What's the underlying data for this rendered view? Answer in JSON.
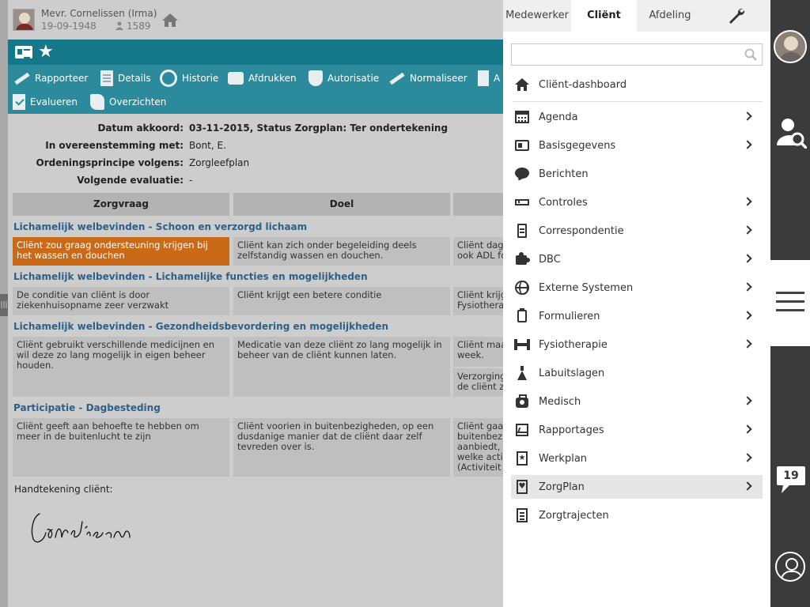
{
  "client": {
    "name": "Mevr. Cornelissen (Irma)",
    "birthdate": "19-09-1948",
    "id_number": "1589"
  },
  "toolbar": {
    "rapporteer": "Rapporteer",
    "details": "Details",
    "historie": "Historie",
    "afdrukken": "Afdrukken",
    "autorisatie": "Autorisatie",
    "normaliseer": "Normaliseer",
    "truncated": "A",
    "evalueren": "Evalueren",
    "overzichten": "Overzichten"
  },
  "plan_info": {
    "datum_label": "Datum akkoord:",
    "datum_value": "03-11-2015, Status Zorgplan: Ter ondertekening",
    "overeenstemming_label": "In overeenstemming met:",
    "overeenstemming_value": "Bont, E.",
    "ordening_label": "Ordeningsprincipe volgens:",
    "ordening_value": "Zorgleefplan",
    "evaluatie_label": "Volgende evaluatie:",
    "evaluatie_value": "-"
  },
  "columns": {
    "zorgvraag": "Zorgvraag",
    "doel": "Doel"
  },
  "sections": [
    {
      "title": "Lichamelijk welbevinden - Schoon en verzorgd lichaam",
      "zorgvraag": "Cliënt zou graag ondersteuning krijgen bij het wassen en douchen",
      "doel": "Cliënt kan zich onder begeleiding deels zelfstandig wassen en douchen.",
      "actie": "Cliënt dag\nook ADL fo"
    },
    {
      "title": "Lichamelijk welbevinden - Lichamelijke functies en mogelijkheden",
      "zorgvraag": "De conditie van cliënt is door ziekenhuisopname zeer verzwakt",
      "doel": "Cliënt krijgt een betere conditie",
      "actie": "Cliënt krijg\nFysiothera"
    },
    {
      "title": "Lichamelijk welbevinden - Gezondheidsbevordering en mogelijkheden",
      "zorgvraag": "Cliënt gebruikt verschillende medicijnen en wil deze zo lang mogelijk in eigen beheer houden.",
      "doel": "Medicatie van deze cliënt zo lang mogelijk in beheer van de cliënt kunnen laten.",
      "actie": "Cliënt maa\nweek.",
      "actie2": "Verzorging\nde cliënt z"
    },
    {
      "title": "Participatie - Dagbesteding",
      "zorgvraag": "Cliënt geeft aan behoefte te hebben om meer in de buitenlucht te zijn",
      "doel": "Cliënt voorien in buitenbezigheden, op een dusdanige manier dat de cliënt daar zelf tevreden over is.",
      "actie": "Cliënt gaa\nbuitenbezi\naanbiedt,\nwelke acti\n(Activiteit"
    }
  ],
  "signature": {
    "label": "Handtekening cliënt:",
    "text": "Cornelissen"
  },
  "menu": {
    "tabs": [
      "Medewerker",
      "Cliënt",
      "Afdeling"
    ],
    "active_tab": "Cliënt",
    "search_value": "",
    "items": [
      {
        "label": "Cliënt-dashboard",
        "icon": "home-icon",
        "chevron": false
      },
      {
        "label": "Agenda",
        "icon": "calendar-icon",
        "chevron": true
      },
      {
        "label": "Basisgegevens",
        "icon": "id-card-icon",
        "chevron": true
      },
      {
        "label": "Berichten",
        "icon": "speech-bubble-icon",
        "chevron": false
      },
      {
        "label": "Controles",
        "icon": "ruler-icon",
        "chevron": true
      },
      {
        "label": "Correspondentie",
        "icon": "document-icon",
        "chevron": true
      },
      {
        "label": "DBC",
        "icon": "puzzle-icon",
        "chevron": true
      },
      {
        "label": "Externe Systemen",
        "icon": "globe-icon",
        "chevron": true
      },
      {
        "label": "Formulieren",
        "icon": "clipboard-icon",
        "chevron": true
      },
      {
        "label": "Fysiotherapie",
        "icon": "dumbbell-icon",
        "chevron": true
      },
      {
        "label": "Labuitslagen",
        "icon": "flask-icon",
        "chevron": false
      },
      {
        "label": "Medisch",
        "icon": "medical-bag-icon",
        "chevron": true
      },
      {
        "label": "Rapportages",
        "icon": "chart-icon",
        "chevron": true
      },
      {
        "label": "Werkplan",
        "icon": "star-document-icon",
        "chevron": true
      },
      {
        "label": "ZorgPlan",
        "icon": "heart-document-icon",
        "chevron": true,
        "highlighted": true
      },
      {
        "label": "Zorgtrajecten",
        "icon": "list-document-icon",
        "chevron": false
      }
    ]
  },
  "right_bar": {
    "notification_count": "19"
  },
  "colors": {
    "teal_bar": "#14778a",
    "toolbar": "#2b8a9b",
    "highlight_cell": "#c86a18",
    "section_title": "#2f5f86",
    "sidebar": "#3b3b3b"
  }
}
